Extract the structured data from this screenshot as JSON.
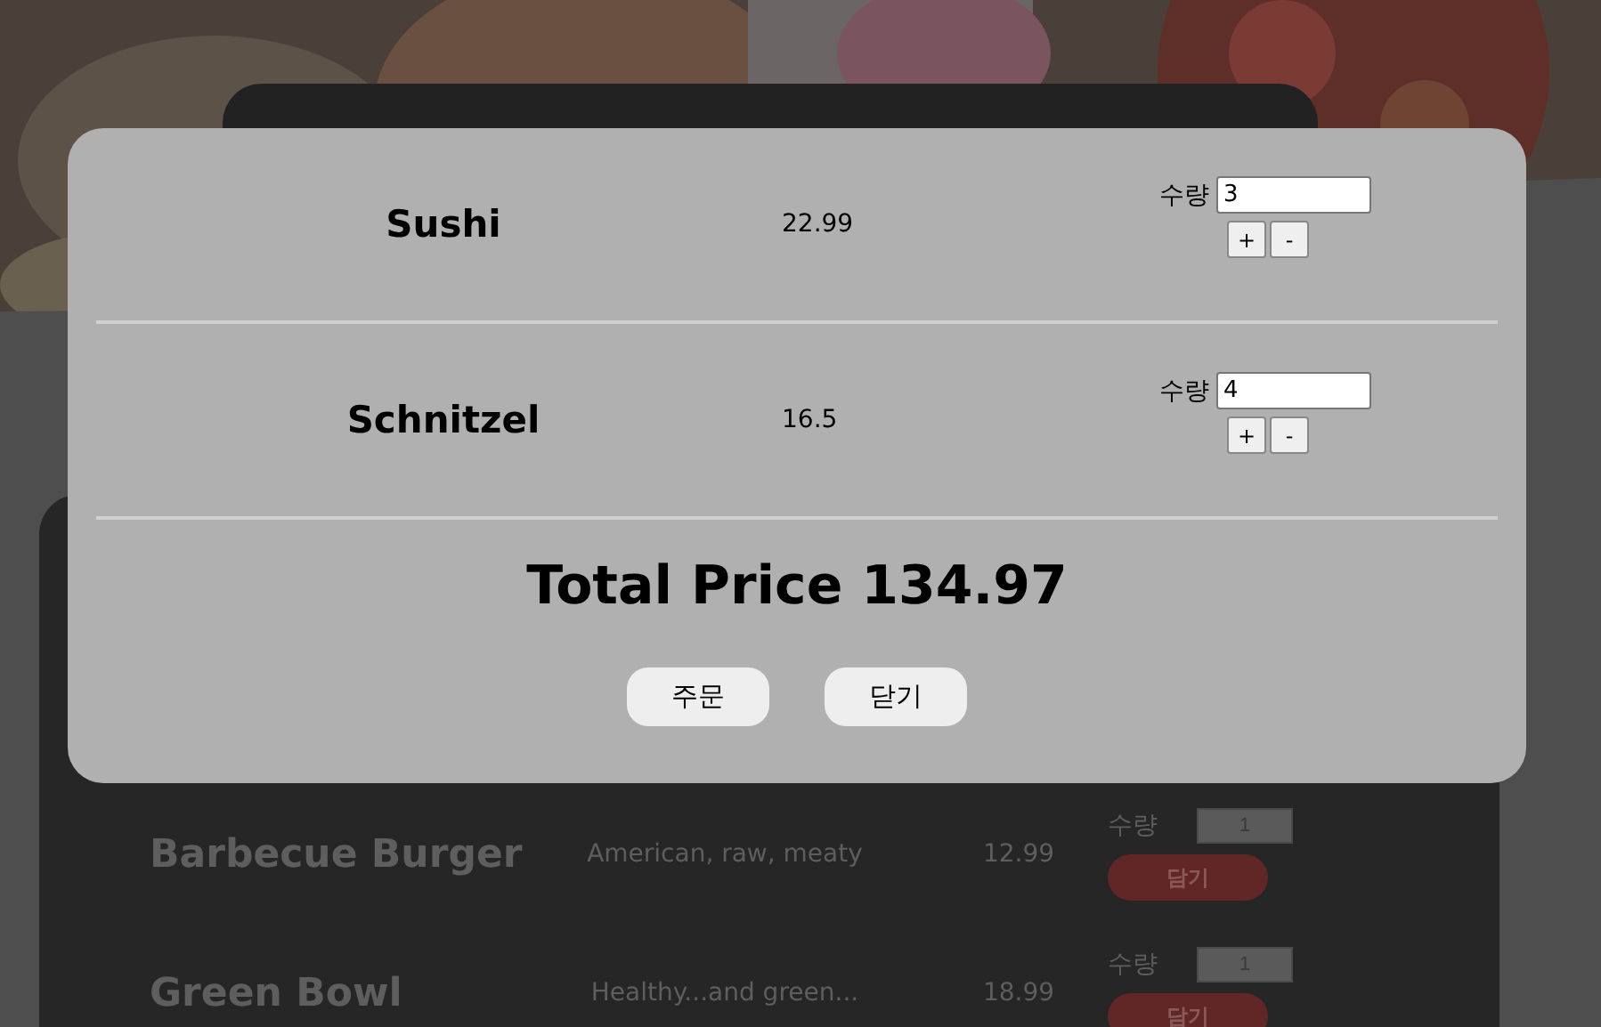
{
  "menu": {
    "items": [
      {
        "name": "Barbecue Burger",
        "description": "American, raw, meaty",
        "price": "12.99",
        "qty_label": "수량",
        "qty": "1",
        "add_button": "담기"
      },
      {
        "name": "Green Bowl",
        "description": "Healthy...and green...",
        "price": "18.99",
        "qty_label": "수량",
        "qty": "1",
        "add_button": "담기"
      }
    ]
  },
  "cart_modal": {
    "items": [
      {
        "name": "Sushi",
        "price": "22.99",
        "qty_label": "수량",
        "qty": "3",
        "plus": "+",
        "minus": "-"
      },
      {
        "name": "Schnitzel",
        "price": "16.5",
        "qty_label": "수량",
        "qty": "4",
        "plus": "+",
        "minus": "-"
      }
    ],
    "total": "Total Price 134.97",
    "buttons": [
      "주문",
      "닫기"
    ]
  }
}
